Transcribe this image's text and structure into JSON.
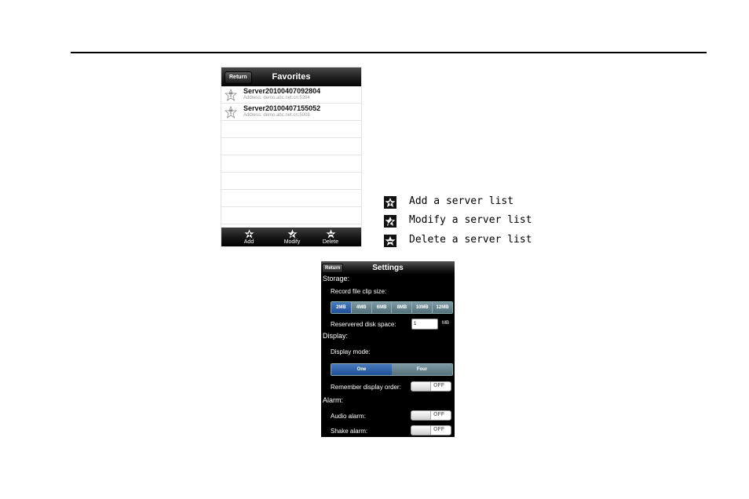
{
  "favorites": {
    "return_label": "Return",
    "title": "Favorites",
    "servers": [
      {
        "name": "Server20100407092804",
        "address": "Address: demo.abc.net.cn:5204"
      },
      {
        "name": "Server20100407155052",
        "address": "Address: demo.abc.net.cn:5008"
      }
    ],
    "toolbar": {
      "add_label": "Add",
      "modify_label": "Modify",
      "delete_label": "Delete"
    }
  },
  "legend": {
    "items": [
      {
        "icon": "add-star-icon",
        "text": "Add a server list"
      },
      {
        "icon": "modify-star-icon",
        "text": "Modify a server list"
      },
      {
        "icon": "delete-star-icon",
        "text": "Delete a server list"
      }
    ]
  },
  "settings": {
    "return_label": "Return",
    "title": "Settings",
    "storage_heading": "Storage:",
    "clip_size_label": "Record file clip size:",
    "clip_sizes": [
      "2MB",
      "4MB",
      "6MB",
      "8MB",
      "10MB",
      "12MB"
    ],
    "clip_size_selected": "2MB",
    "disk_space_label": "Reservered disk space:",
    "disk_space_value": "1",
    "disk_space_unit": "MB",
    "display_heading": "Display:",
    "display_mode_label": "Display mode:",
    "display_modes": [
      "One",
      "Four"
    ],
    "display_mode_selected": "One",
    "remember_order_label": "Remember display order:",
    "remember_order_value": "OFF",
    "alarm_heading": "Alarm:",
    "audio_alarm_label": "Audio alarm:",
    "audio_alarm_value": "OFF",
    "shake_alarm_label": "Shake alarm:",
    "shake_alarm_value": "OFF"
  },
  "colors": {
    "selected_segment": "#1f4f95",
    "unselected_segment": "#55717c",
    "bar_dark": "#000000"
  }
}
